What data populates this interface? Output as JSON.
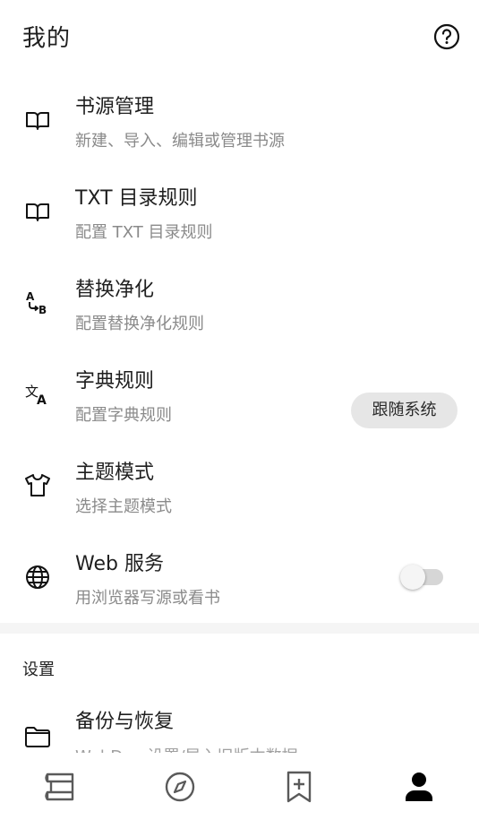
{
  "appbar": {
    "title": "我的",
    "help_icon": "help-circle-icon"
  },
  "items": [
    {
      "label": "书源管理",
      "sub": "新建、导入、编辑或管理书源",
      "icon": "book-open-icon"
    },
    {
      "label": "TXT 目录规则",
      "sub": "配置 TXT 目录规则",
      "icon": "book-open-icon"
    },
    {
      "label": "替换净化",
      "sub": "配置替换净化规则",
      "icon": "a-to-b-icon"
    },
    {
      "label": "字典规则",
      "sub": "配置字典规则",
      "icon": "translate-icon"
    },
    {
      "label": "主题模式",
      "sub": "选择主题模式",
      "icon": "tshirt-icon",
      "value": "跟随系统"
    },
    {
      "label": "Web 服务",
      "sub": "用浏览器写源或看书",
      "icon": "globe-icon",
      "enabled": false
    }
  ],
  "section": {
    "title": "设置"
  },
  "backup": {
    "label": "备份与恢复",
    "sub": "WebDav 设置/导入旧版本数据",
    "icon": "folder-icon"
  },
  "bottom_nav": [
    {
      "name": "bookshelf-icon"
    },
    {
      "name": "compass-icon"
    },
    {
      "name": "bookmark-add-icon"
    },
    {
      "name": "person-icon",
      "active": true
    }
  ],
  "colors": {
    "text": "#1f1f1f",
    "subtext": "#8a8a8a",
    "chip_bg": "#e6e6e6",
    "active_nav": "#000000",
    "inactive_nav": "#5a5a5a"
  }
}
